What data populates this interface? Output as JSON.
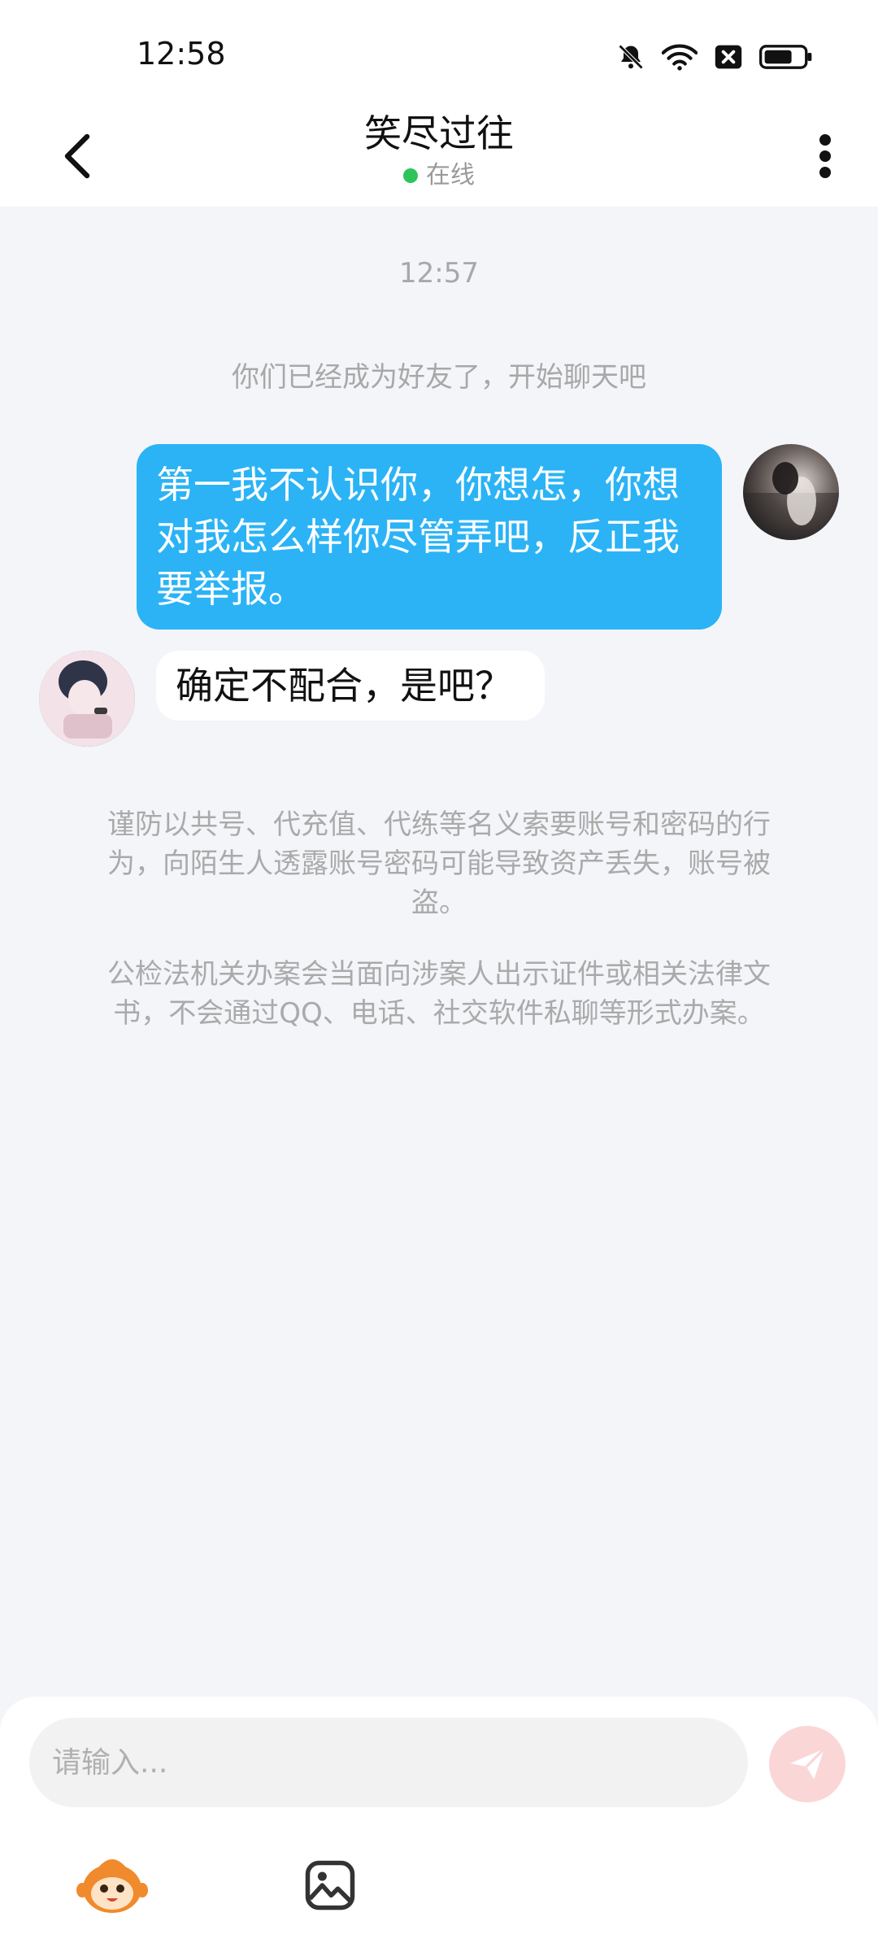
{
  "status_bar": {
    "time": "12:58"
  },
  "header": {
    "title": "笑尽过往",
    "status": "在线",
    "status_color": "#2fc45a"
  },
  "chat": {
    "timestamp": "12:57",
    "system_message": "你们已经成为好友了，开始聊天吧",
    "messages": [
      {
        "from": "self",
        "text": "第一我不认识你，你想怎，你想对我怎么样你尽管弄吧，反正我要举报。"
      },
      {
        "from": "other",
        "text": "确定不配合，是吧？"
      }
    ],
    "warnings": [
      "谨防以共号、代充值、代练等名义索要账号和密码的行为，向陌生人透露账号密码可能导致资产丢失，账号被盗。",
      "公检法机关办案会当面向涉案人出示证件或相关法律文书，不会通过QQ、电话、社交软件私聊等形式办案。"
    ]
  },
  "input": {
    "placeholder": "请输入..."
  },
  "colors": {
    "self_bubble": "#2bb3f6",
    "background": "#f3f5f8",
    "send_button": "#fbd6d6"
  },
  "icons": {
    "status": [
      "bell-muted-icon",
      "wifi-icon",
      "sim-off-icon",
      "battery-icon"
    ],
    "header": [
      "back-arrow-icon",
      "more-vertical-icon"
    ],
    "toolbar": [
      "emoji-mascot-icon",
      "image-icon",
      "send-icon"
    ]
  }
}
